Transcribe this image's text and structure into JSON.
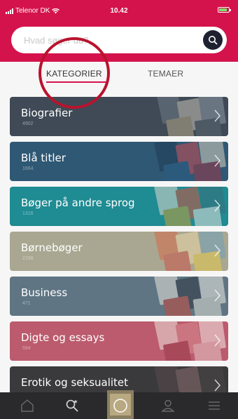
{
  "status_bar": {
    "carrier": "Telenor DK",
    "time": "10.42"
  },
  "search": {
    "placeholder": "Hvad søger du?",
    "icon": "search-icon"
  },
  "tabs": [
    {
      "label": "KATEGORIER",
      "active": true
    },
    {
      "label": "TEMAER",
      "active": false
    }
  ],
  "categories": [
    {
      "label": "Biografier",
      "count": "4902",
      "color": "#3f4a56"
    },
    {
      "label": "Blå titler",
      "count": "1664",
      "color": "#2f5874"
    },
    {
      "label": "Bøger på andre sprog",
      "count": "1316",
      "color": "#1f8b93"
    },
    {
      "label": "Børnebøger",
      "count": "2298",
      "color": "#a9a791"
    },
    {
      "label": "Business",
      "count": "471",
      "color": "#5f7584"
    },
    {
      "label": "Digte og essays",
      "count": "594",
      "color": "#bb5b6d"
    },
    {
      "label": "Erotik og seksualitet",
      "count": "",
      "color": "#3a3a3c"
    }
  ],
  "bottom_nav": {
    "items": [
      "home-icon",
      "search-star-icon",
      "now-reading-thumbnail",
      "profile-icon",
      "menu-icon"
    ]
  },
  "colors": {
    "brand": "#d4134c",
    "annotation": "#b9132e",
    "nav_bg": "#2a2a2c"
  }
}
